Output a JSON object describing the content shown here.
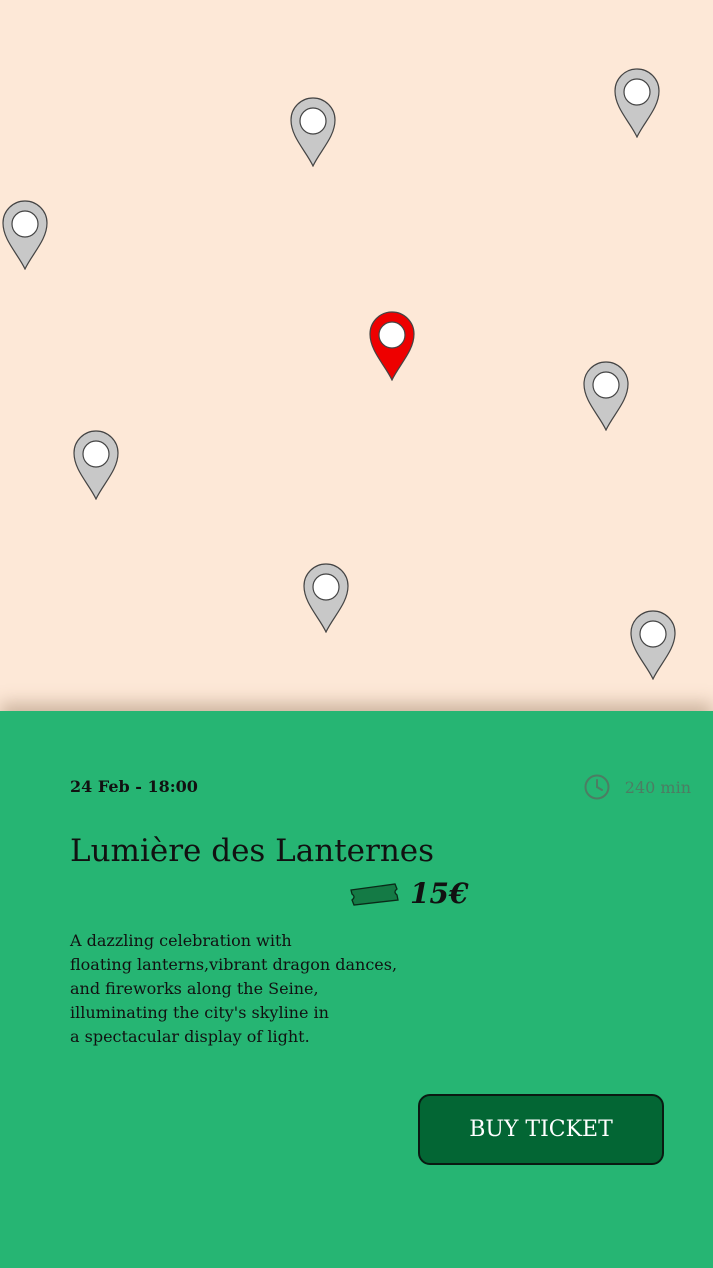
{
  "map": {
    "pins": [
      {
        "name": "map-pin-1",
        "state": "default"
      },
      {
        "name": "map-pin-2",
        "state": "default"
      },
      {
        "name": "map-pin-3",
        "state": "default"
      },
      {
        "name": "map-pin-4",
        "state": "selected"
      },
      {
        "name": "map-pin-5",
        "state": "default"
      },
      {
        "name": "map-pin-6",
        "state": "default"
      },
      {
        "name": "map-pin-7",
        "state": "default"
      },
      {
        "name": "map-pin-8",
        "state": "default"
      }
    ],
    "colors": {
      "background": "#fde8d7",
      "pin_default": "#c8c8c8",
      "pin_selected": "#ee0000",
      "pin_stroke": "#444444"
    }
  },
  "event": {
    "date": "24 Feb - 18:00",
    "duration": "240 min",
    "duration_icon": "clock-icon",
    "title": "Lumière des Lanternes",
    "price_icon": "ticket-icon",
    "price": "15€",
    "description_lines": [
      "A dazzling celebration with",
      "floating lanterns,vibrant dragon dances,",
      "and fireworks along the Seine,",
      "illuminating the city's skyline in",
      "a spectacular display of light."
    ],
    "buy_label": "BUY TICKET"
  },
  "colors": {
    "sheet": "#26b573",
    "button": "#036634",
    "button_text": "#ffffff",
    "muted": "#4c7d63"
  }
}
